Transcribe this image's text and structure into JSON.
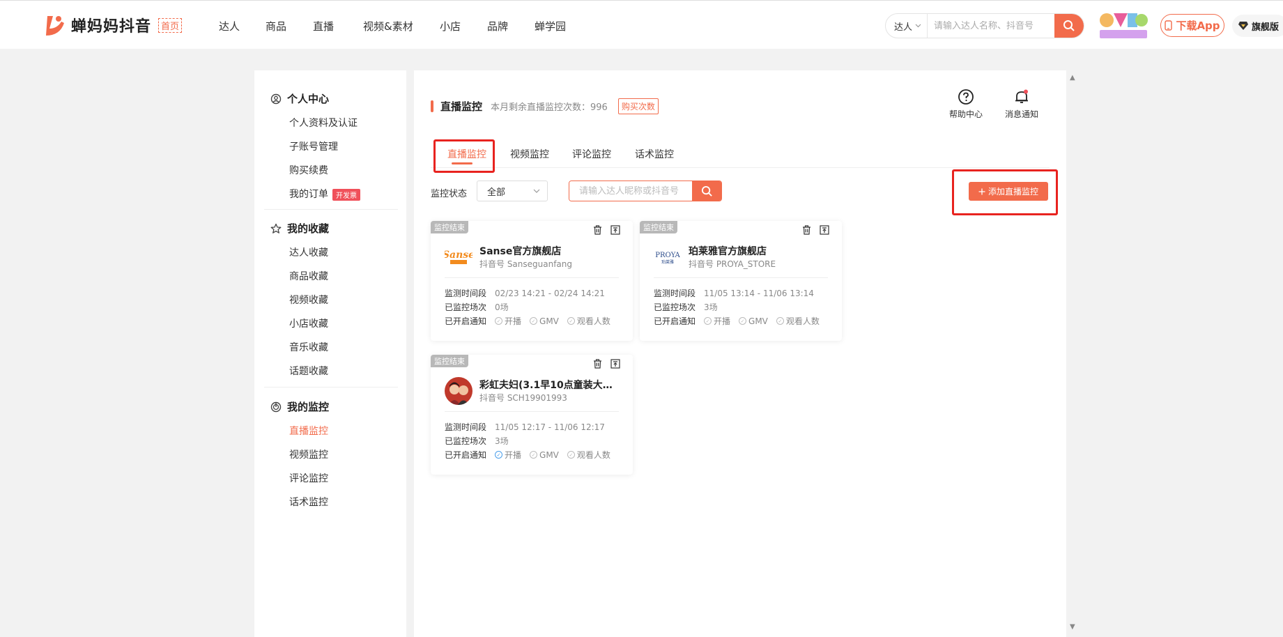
{
  "header": {
    "logo_text": "蝉妈妈抖音",
    "home_label": "首页",
    "nav": [
      "达人",
      "商品",
      "直播",
      "视频&素材",
      "小店",
      "品牌",
      "蝉学园"
    ],
    "search_category": "达人",
    "search_placeholder": "请输入达人名称、抖音号",
    "download_label": "下载App",
    "flagship_label": "旗舰版",
    "gmg_icon": "gmg-annual-conference-logo"
  },
  "sidebar": {
    "sections": [
      {
        "title": "个人中心",
        "icon": "user-circle-icon",
        "items": [
          "个人资料及认证",
          "子账号管理",
          "购买续费",
          "我的订单"
        ]
      },
      {
        "title": "我的收藏",
        "icon": "star-icon",
        "items": [
          "达人收藏",
          "商品收藏",
          "视频收藏",
          "小店收藏",
          "音乐收藏",
          "话题收藏"
        ]
      },
      {
        "title": "我的监控",
        "icon": "radar-icon",
        "items": [
          "直播监控",
          "视频监控",
          "评论监控",
          "话术监控"
        ]
      }
    ],
    "invoice_tag": "开发票",
    "active_item": "直播监控"
  },
  "main": {
    "title": "直播监控",
    "remain_text": "本月剩余直播监控次数：996",
    "buy_label": "购买次数",
    "help_label": "帮助中心",
    "notify_label": "消息通知",
    "tabs": [
      "直播监控",
      "视频监控",
      "评论监控",
      "话术监控"
    ],
    "active_tab": "直播监控",
    "filter_label": "监控状态",
    "filter_value": "全部",
    "search_placeholder": "请输入达人昵称或抖音号",
    "add_label": "添加直播监控",
    "accent_color": "#f26b4b",
    "row_labels": {
      "period": "监测时间段",
      "count": "已监控场次",
      "notify": "已开启通知"
    },
    "notify_options": [
      "开播",
      "GMV",
      "观看人数"
    ],
    "cards": [
      {
        "tag": "监控结束",
        "name": "Sanse官方旗舰店",
        "id": "抖音号 Sanseguanfang",
        "period": "02/23 14:21 - 02/24 14:21",
        "count": "0场",
        "notify_on": [],
        "logo": "sanse-logo"
      },
      {
        "tag": "监控结束",
        "name": "珀莱雅官方旗舰店",
        "id": "抖音号 PROYA_STORE",
        "period": "11/05 13:14 - 11/06 13:14",
        "count": "3场",
        "notify_on": [],
        "logo": "proya-logo"
      },
      {
        "tag": "监控结束",
        "name": "彩虹夫妇(3.1早10点童装大破…",
        "id": "抖音号 SCH19901993",
        "period": "11/05 12:17 - 11/06 12:17",
        "count": "3场",
        "notify_on": [
          "开播"
        ],
        "logo": "couple-avatar"
      }
    ],
    "logo_texts": {
      "sanse": "Sanse",
      "proya": "PROYA",
      "proya_sub": "珀莱雅"
    }
  }
}
